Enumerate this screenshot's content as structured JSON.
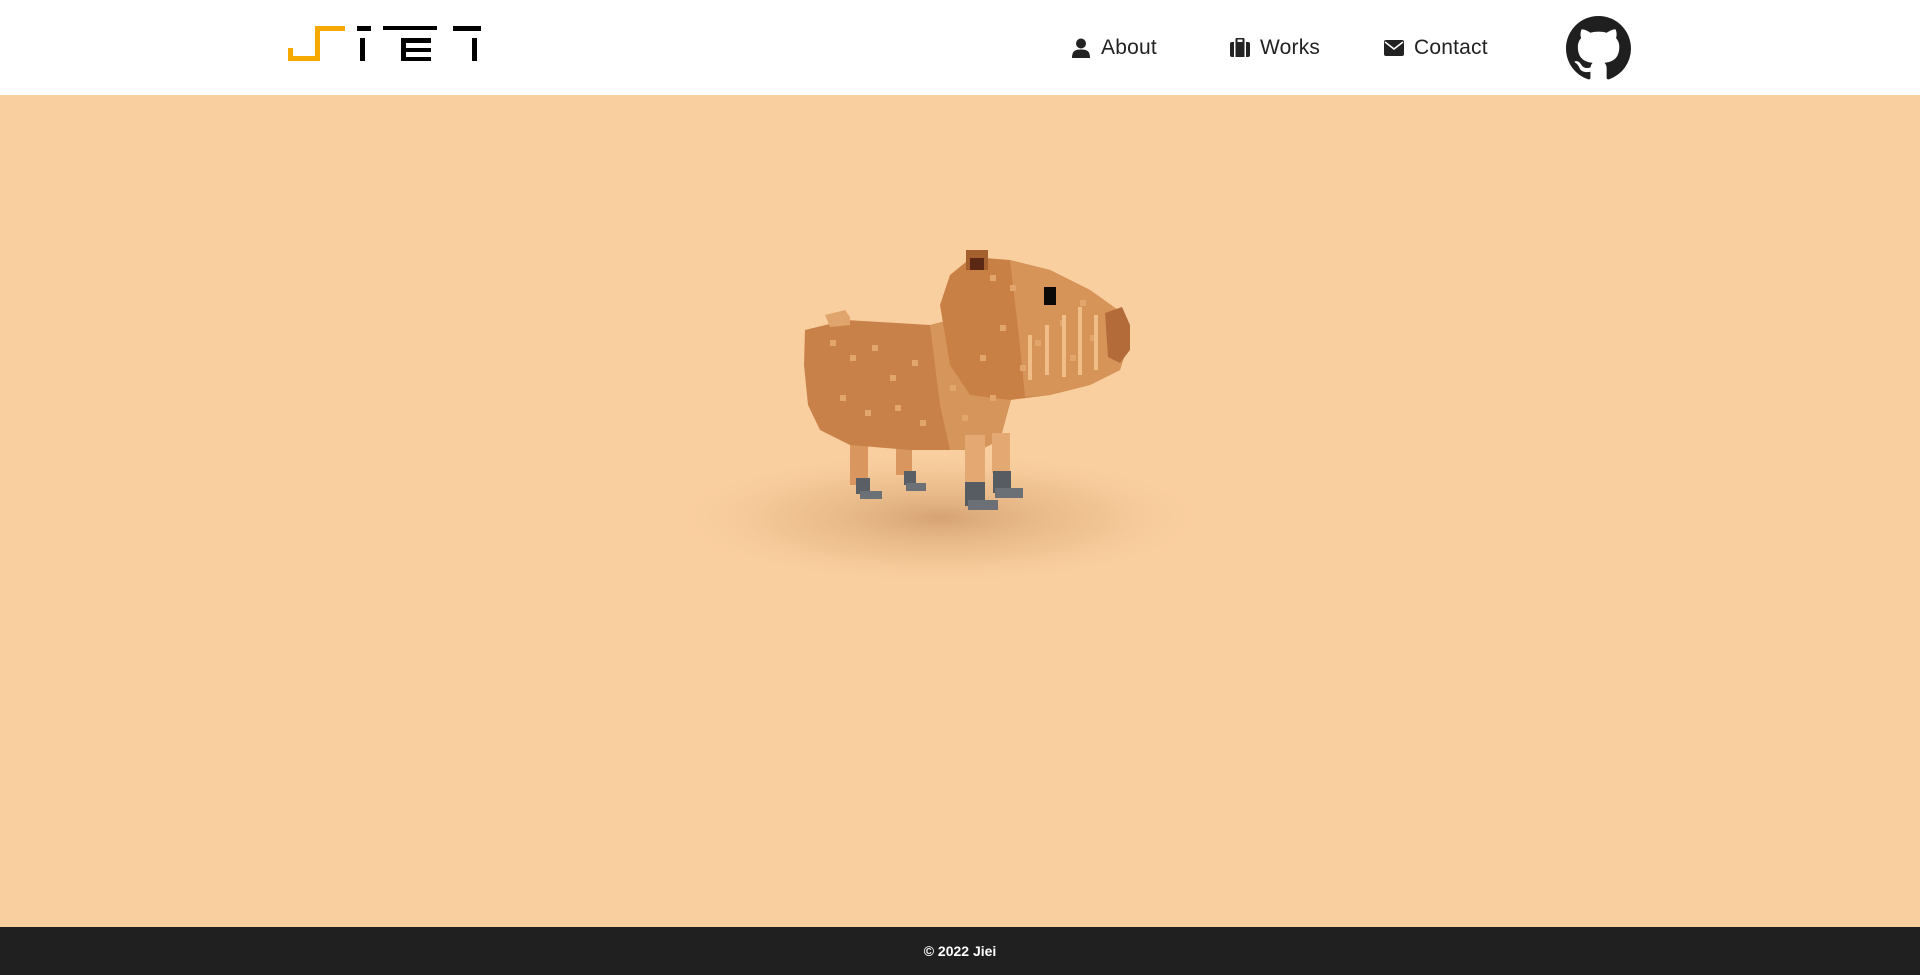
{
  "header": {
    "nav": [
      {
        "label": "About",
        "icon": "user-icon"
      },
      {
        "label": "Works",
        "icon": "briefcase-icon"
      },
      {
        "label": "Contact",
        "icon": "envelope-icon"
      }
    ],
    "github_icon": "github-icon"
  },
  "logo": {
    "text": "Jiei",
    "accent_color": "#F5A800",
    "text_color": "#000000"
  },
  "main": {
    "background_color": "#FACF9F",
    "model": "capybara-voxel"
  },
  "footer": {
    "text": "© 2022 Jiei",
    "background_color": "#202020"
  }
}
